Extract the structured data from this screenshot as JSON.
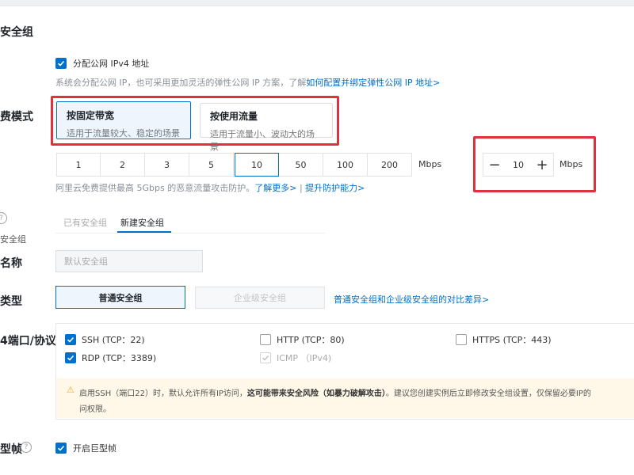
{
  "section_titles": {
    "security_group": "安全组",
    "billing_mode": "费模式",
    "name": "名称",
    "type": "类型",
    "ports": "4端口/协议",
    "jumbo": "型帧"
  },
  "public_ip": {
    "checkbox_label": "分配公网 IPv4 地址",
    "hint": "系统会分配公网 IP，也可采用更加灵活的弹性公网 IP 方案，了解",
    "hint_link": "如何配置并绑定弹性公网 IP 地址>"
  },
  "billing": {
    "options": [
      {
        "title": "按固定带宽",
        "desc": "适用于流量较大、稳定的场景"
      },
      {
        "title": "按使用流量",
        "desc": "适用于流量小、波动大的场景"
      }
    ]
  },
  "bandwidth": {
    "values": [
      "1",
      "2",
      "3",
      "5",
      "10",
      "50",
      "100",
      "200"
    ],
    "selected": "10",
    "unit": "Mbps",
    "stepper_value": "10",
    "stepper_unit": "Mbps",
    "minus": "−",
    "plus": "+"
  },
  "ddos": {
    "text": "阿里云免费提供最高 5Gbps 的恶意流量攻击防护。",
    "link1": "了解更多>",
    "sep": "|",
    "link2": "提升防护能力>"
  },
  "sg_tabs": {
    "help": "?",
    "side_label": "安全组",
    "existing": "已有安全组",
    "new": "新建安全组"
  },
  "sg_name": {
    "placeholder": "默认安全组"
  },
  "sg_type": {
    "normal": "普通安全组",
    "enterprise": "企业级安全组",
    "compare_link": "普通安全组和企业级安全组的对比差异>"
  },
  "ports": [
    {
      "label": "SSH (TCP：22)",
      "state": "on"
    },
    {
      "label": "HTTP (TCP：80)",
      "state": "off"
    },
    {
      "label": "HTTPS (TCP：443)",
      "state": "off"
    },
    {
      "label": "RDP (TCP：3389)",
      "state": "on"
    },
    {
      "label": "ICMP （IPv4)",
      "state": "dis"
    }
  ],
  "warning": {
    "icon": "⚠",
    "line1_a": "启用SSH（端口22）时，默认允许所有IP访问，",
    "line1_b": "这可能带来安全风险（如暴力破解攻击）",
    "line1_c": "。建议您创建实例后立即修改安全组设置，仅保留必要IP的",
    "line2": "问权限。"
  },
  "jumbo": {
    "help": "?",
    "checkbox_label": "开启巨型帧"
  },
  "colors": {
    "accent": "#0070cc",
    "highlight": "#e0303b",
    "warning_bg": "#fff8e8",
    "warning_icon": "#f5a623"
  }
}
